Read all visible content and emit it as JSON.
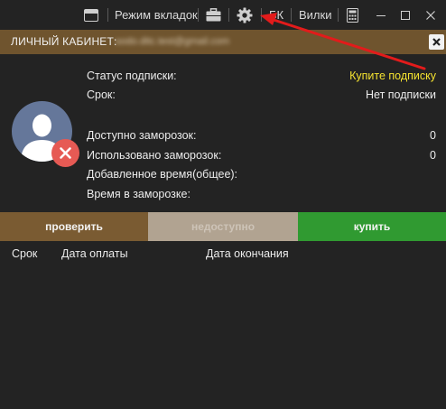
{
  "toolbar": {
    "tabs_mode_label": "Режим вкладок",
    "bk_label": "БК",
    "forks_label": "Вилки",
    "icons": [
      "window-icon",
      "briefcase-icon",
      "gear-icon",
      "calculator-icon",
      "minimize-icon",
      "maximize-icon",
      "close-icon"
    ]
  },
  "header": {
    "title": "ЛИЧНЫЙ КАБИНЕТ:",
    "email": "sodo.ditc.test@gmail.com"
  },
  "subscription": {
    "status_label": "Статус подписки:",
    "status_value": "Купите подписку",
    "term_label": "Срок:",
    "term_value": "Нет подписки",
    "freezes_available_label": "Доступно заморозок:",
    "freezes_available_value": "0",
    "freezes_used_label": "Использовано заморозок:",
    "freezes_used_value": "0",
    "added_time_label": "Добавленное время(общее):",
    "freeze_time_label": "Время в заморозке:"
  },
  "actions": {
    "check_label": "проверить",
    "unavailable_label": "недоступно",
    "buy_label": "купить"
  },
  "payments_table": {
    "columns": [
      "Срок",
      "Дата оплаты",
      "Дата окончания"
    ],
    "rows": []
  },
  "colors": {
    "accent_yellow": "#f4e230",
    "header_brown": "#6f542e",
    "buy_green": "#309a31",
    "annotation_arrow": "#e21b1b"
  }
}
